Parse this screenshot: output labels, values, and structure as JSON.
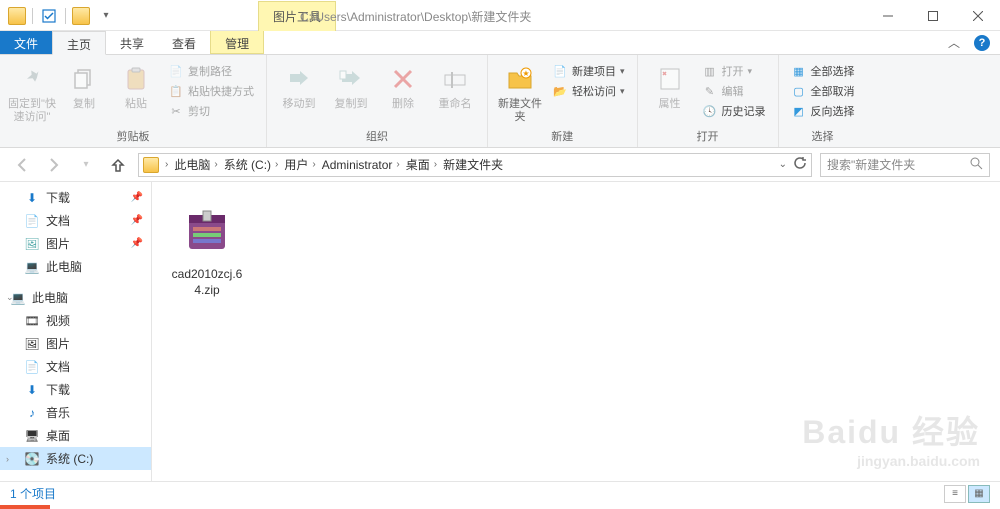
{
  "title_path": "C:\\Users\\Administrator\\Desktop\\新建文件夹",
  "contextual_tab": "图片工具",
  "tabs": {
    "file": "文件",
    "home": "主页",
    "share": "共享",
    "view": "查看",
    "manage": "管理"
  },
  "ribbon": {
    "clipboard": {
      "pin": "固定到\"快速访问\"",
      "copy": "复制",
      "paste": "粘贴",
      "copy_path": "复制路径",
      "paste_shortcut": "粘贴快捷方式",
      "cut": "剪切",
      "label": "剪贴板"
    },
    "organize": {
      "move_to": "移动到",
      "copy_to": "复制到",
      "delete": "删除",
      "rename": "重命名",
      "label": "组织"
    },
    "new": {
      "new_folder": "新建文件夹",
      "new_item": "新建项目",
      "easy_access": "轻松访问",
      "label": "新建"
    },
    "open": {
      "properties": "属性",
      "open": "打开",
      "edit": "编辑",
      "history": "历史记录",
      "label": "打开"
    },
    "select": {
      "select_all": "全部选择",
      "select_none": "全部取消",
      "invert": "反向选择",
      "label": "选择"
    }
  },
  "breadcrumb": [
    "此电脑",
    "系统 (C:)",
    "用户",
    "Administrator",
    "桌面",
    "新建文件夹"
  ],
  "search_placeholder": "搜索\"新建文件夹",
  "sidebar": {
    "downloads": "下载",
    "documents": "文档",
    "pictures": "图片",
    "this_pc": "此电脑",
    "this_pc2": "此电脑",
    "videos": "视频",
    "pictures2": "图片",
    "documents2": "文档",
    "downloads2": "下载",
    "music": "音乐",
    "desktop": "桌面",
    "system_c": "系统 (C:)"
  },
  "files": [
    {
      "name": "cad2010zcj.64.zip"
    }
  ],
  "status": "1 个项目",
  "watermark": {
    "brand": "Baidu 经验",
    "url": "jingyan.baidu.com"
  }
}
